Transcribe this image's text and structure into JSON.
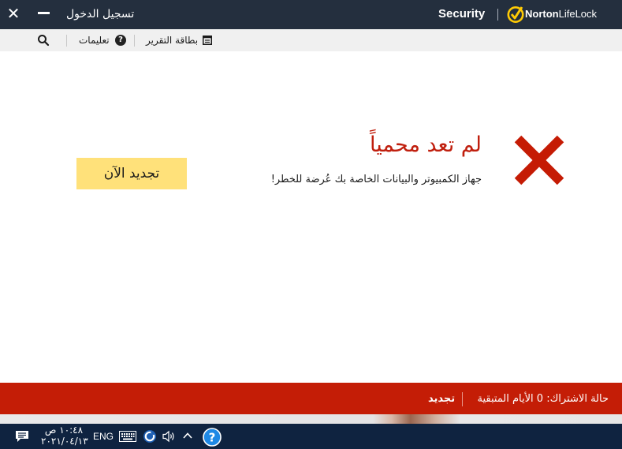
{
  "titlebar": {
    "close_label": "✕",
    "login_label": "تسجيل الدخول",
    "brand_security": "Security",
    "brand_norton_bold": "Norton",
    "brand_norton_rest": "LifeLock"
  },
  "toolbar": {
    "search_icon": "search-icon",
    "help_label": "تعليمات",
    "report_label": "بطاقة التقرير"
  },
  "status": {
    "title": "لم تعد محمياً",
    "description": "جهاز الكمبيوتر والبيانات الخاصة بك عُرضة للخطر!",
    "icon": "x-icon",
    "icon_color": "#c51b04"
  },
  "renew_button": {
    "label": "تجديد الآن",
    "color": "#ffe17a"
  },
  "footer": {
    "status_text": "حالة الاشتراك:  0 الأيام المتبقية",
    "renew_label": "تجديد",
    "color": "#c41d06"
  },
  "taskbar": {
    "time": "١٠:٤٨ ص",
    "date": "٢٠٢١/٠٤/١٣",
    "language": "ENG"
  }
}
